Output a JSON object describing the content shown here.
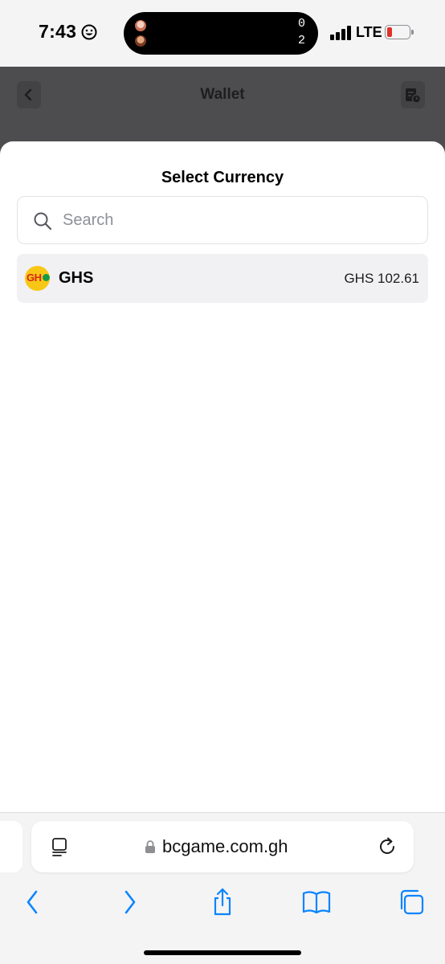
{
  "status_bar": {
    "time": "7:43",
    "live_activity": {
      "score_top": "0",
      "score_bottom": "2"
    },
    "network": "LTE"
  },
  "page": {
    "title": "Wallet"
  },
  "sheet": {
    "title": "Select Currency",
    "search_placeholder": "Search",
    "currencies": [
      {
        "code": "GHS",
        "logo_text": "GH",
        "balance": "GHS 102.61"
      }
    ]
  },
  "browser": {
    "url": "bcgame.com.gh"
  },
  "colors": {
    "battery_low": "#e0312b",
    "safari_blue": "#0a84ff",
    "ghs_logo_yellow": "#f8c715",
    "ghs_logo_red": "#d7261e",
    "ghs_logo_green": "#159a42"
  }
}
